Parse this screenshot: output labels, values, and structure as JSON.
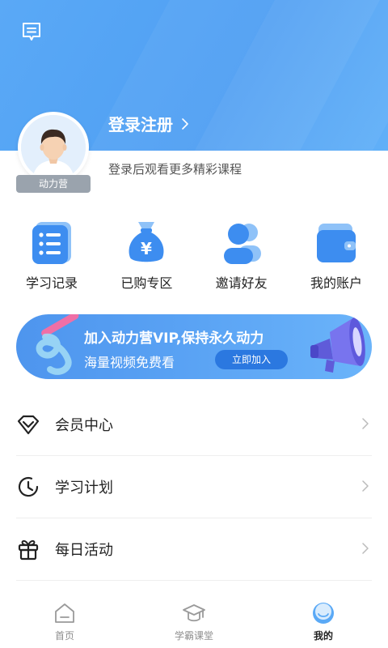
{
  "header": {
    "message_icon": "message-icon"
  },
  "profile": {
    "badge": "动力营",
    "login_label": "登录注册",
    "hint": "登录后观看更多精彩课程"
  },
  "quick_actions": [
    {
      "label": "学习记录",
      "icon": "list-doc-icon"
    },
    {
      "label": "已购专区",
      "icon": "money-bag-icon"
    },
    {
      "label": "邀请好友",
      "icon": "friends-icon"
    },
    {
      "label": "我的账户",
      "icon": "wallet-icon"
    }
  ],
  "banner": {
    "title": "加入动力营VIP,保持永久动力",
    "subtitle": "海量视频免费看",
    "button": "立即加入"
  },
  "menu": [
    {
      "label": "会员中心",
      "icon": "diamond-icon"
    },
    {
      "label": "学习计划",
      "icon": "clock-icon"
    },
    {
      "label": "每日活动",
      "icon": "gift-icon"
    }
  ],
  "tabbar": {
    "items": [
      {
        "label": "首页",
        "icon": "home-icon"
      },
      {
        "label": "学霸课堂",
        "icon": "graduation-cap-icon"
      },
      {
        "label": "我的",
        "icon": "profile-circle-icon"
      }
    ],
    "active_index": 2
  },
  "colors": {
    "primary": "#4f9ff3",
    "icon_blue": "#3d8df0",
    "icon_light": "#8fc2f8"
  }
}
